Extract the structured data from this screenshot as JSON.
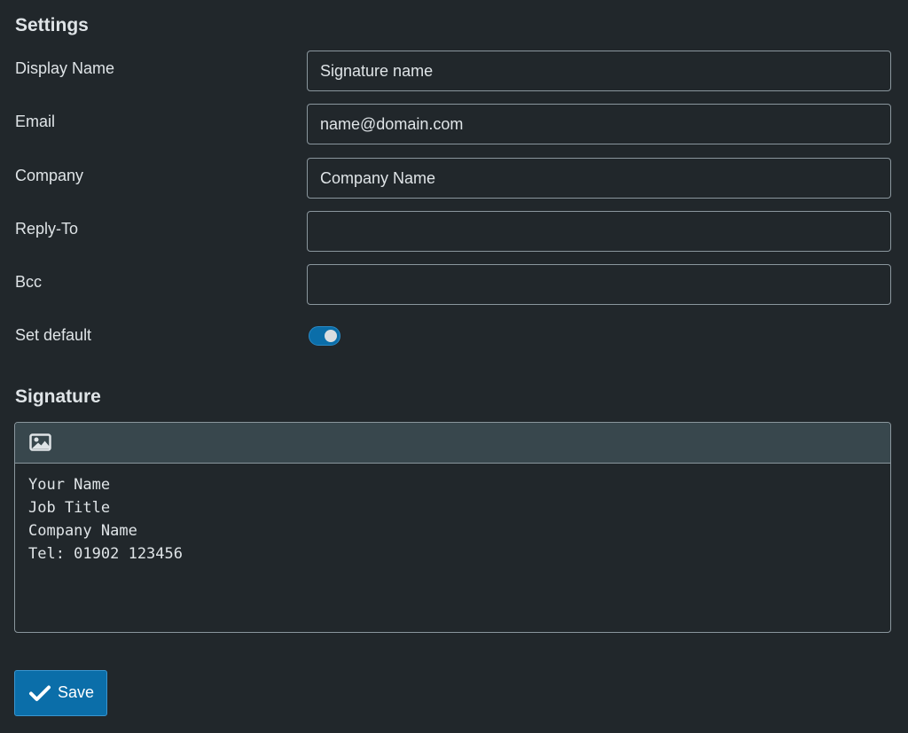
{
  "settings": {
    "title": "Settings",
    "fields": [
      {
        "label": "Display Name",
        "placeholder": "Signature name",
        "value": ""
      },
      {
        "label": "Email",
        "placeholder": "name@domain.com",
        "value": ""
      },
      {
        "label": "Company",
        "placeholder": "Company Name",
        "value": ""
      },
      {
        "label": "Reply-To",
        "placeholder": "",
        "value": ""
      },
      {
        "label": "Bcc",
        "placeholder": "",
        "value": ""
      }
    ],
    "default_toggle": {
      "label": "Set default",
      "on": true
    }
  },
  "signature": {
    "title": "Signature",
    "toolbar_icon": "image-icon",
    "content": "Your Name\nJob Title\nCompany Name\nTel: 01902 123456"
  },
  "save_button": {
    "label": "Save",
    "icon": "checkmark-icon"
  },
  "colors": {
    "background": "#21272b",
    "accent": "#0b6ea9",
    "toolbar": "#38474d",
    "border": "#8a969d"
  }
}
